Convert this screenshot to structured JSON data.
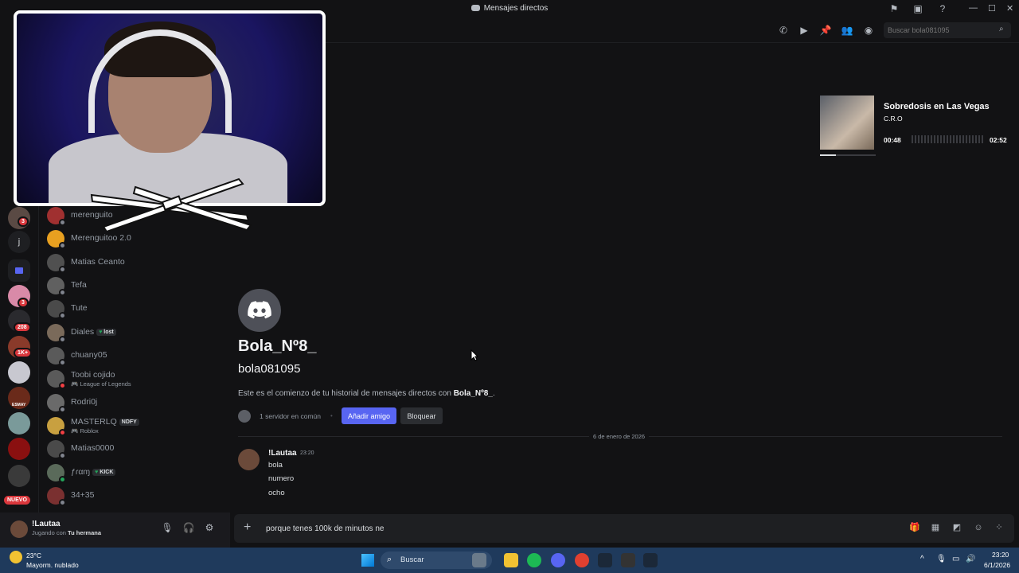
{
  "window": {
    "title": "Mensajes directos"
  },
  "server_rail": {
    "badges": [
      "3",
      "3",
      "208",
      "1K+"
    ],
    "letter": "j",
    "new_label": "NUEVO",
    "server_label": "ESMAY"
  },
  "dm_list": [
    {
      "name": "merenguito",
      "status": "offline"
    },
    {
      "name": "Merenguitoo 2.0",
      "status": "offline"
    },
    {
      "name": "Matias Ceanto",
      "status": "offline"
    },
    {
      "name": "Tefa",
      "status": "offline"
    },
    {
      "name": "Tute",
      "status": "offline"
    },
    {
      "name": "Diales",
      "tag": "lost",
      "status": "offline"
    },
    {
      "name": "chuany05",
      "status": "offline"
    },
    {
      "name": "Toobi cojido",
      "activity": "League of Legends",
      "status": "dnd"
    },
    {
      "name": "Rodri0j",
      "status": "offline"
    },
    {
      "name": "MASTERLQ",
      "tag": "NDFY",
      "activity": "Roblox",
      "status": "dnd"
    },
    {
      "name": "Matias0000",
      "status": "offline"
    },
    {
      "name": "ƒɾαɱ",
      "tag": "KICK",
      "status": "online"
    },
    {
      "name": "34+35",
      "status": "offline"
    }
  ],
  "user_panel": {
    "username": "!Lautaa",
    "status_prefix": "Jugando con",
    "status_game": "Tu hermana"
  },
  "header": {
    "search_placeholder": "Buscar bola081095"
  },
  "profile": {
    "display_name": "Bola_Nº8_",
    "handle": "bola081095",
    "intro_prefix": "Este es el comienzo de tu historial de mensajes directos con ",
    "intro_name": "Bola_Nº8_",
    "intro_suffix": ".",
    "mutual_servers": "1 servidor en común",
    "add_friend": "Añadir amigo",
    "block": "Bloquear"
  },
  "messages": {
    "date_divider": "6 de enero de 2026",
    "author": "!Lautaa",
    "time": "23:20",
    "lines": [
      "bola",
      "numero",
      "ocho"
    ]
  },
  "composer": {
    "value": "porque tenes 100k de minutos ne"
  },
  "music": {
    "song": "Sobredosis en Las Vegas",
    "artist": "C.R.O",
    "elapsed": "00:48",
    "total": "02:52",
    "progress": 0.28
  },
  "taskbar": {
    "temperature": "23°C",
    "weather": "Mayorm. nublado",
    "search_label": "Buscar",
    "time": "23:20",
    "date": "6/1/2026"
  },
  "colors": {
    "accent": "#5865f2",
    "background": "#121214",
    "taskbar": "#1f3a5c",
    "badge": "#da373c"
  }
}
